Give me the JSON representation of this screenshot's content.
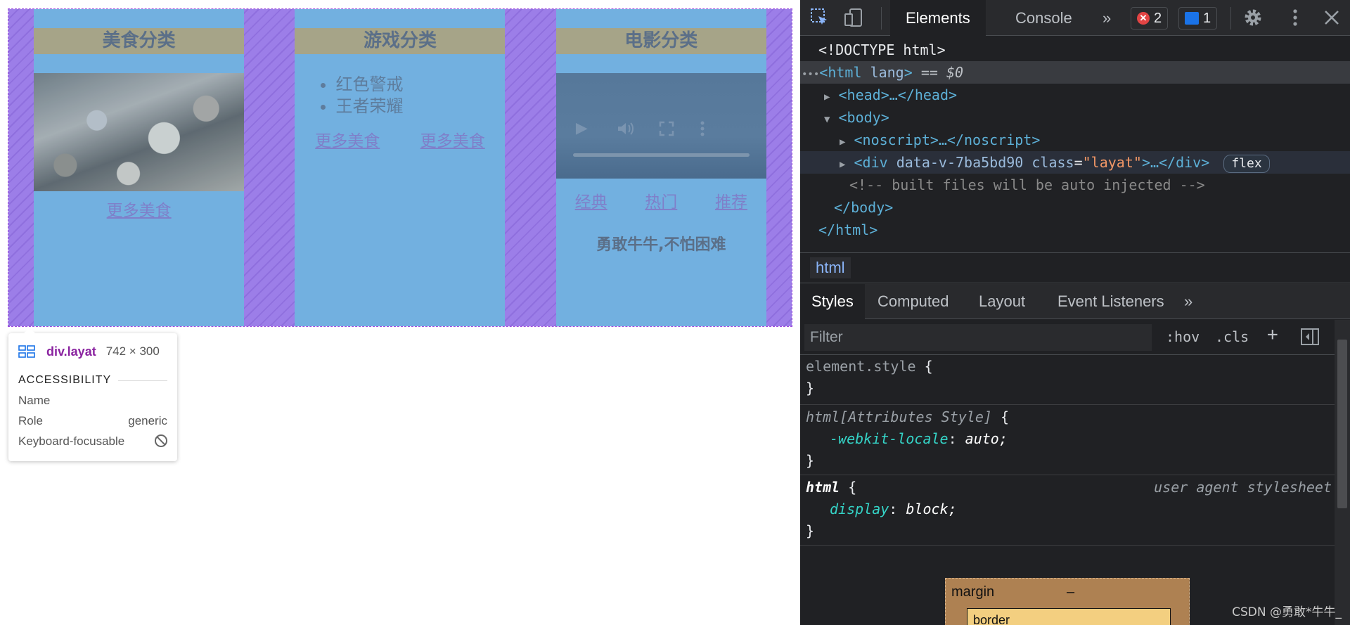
{
  "page": {
    "cards": {
      "food": {
        "title": "美食分类",
        "more_link": "更多美食"
      },
      "game": {
        "title": "游戏分类",
        "items": [
          "红色警戒",
          "王者荣耀"
        ],
        "links": [
          "更多美食",
          "更多美食"
        ]
      },
      "movie": {
        "title": "电影分类",
        "links": [
          "经典",
          "热门",
          "推荐"
        ],
        "motto": "勇敢牛牛,不怕困难"
      }
    },
    "tooltip": {
      "element_name": "div.layat",
      "size": "742 × 300",
      "section": "ACCESSIBILITY",
      "rows": [
        {
          "label": "Name",
          "value": ""
        },
        {
          "label": "Role",
          "value": "generic"
        },
        {
          "label": "Keyboard-focusable",
          "value": ""
        }
      ]
    }
  },
  "devtools": {
    "tabs": {
      "elements": "Elements",
      "console": "Console",
      "more": "»"
    },
    "errors_count": "2",
    "messages_count": "1",
    "error_glyph": "✕",
    "dom": {
      "doctype": "<!DOCTYPE html>",
      "html_open_tag": "<html",
      "html_attr": "lang",
      "html_rest": ">",
      "html_suffix": " == $0",
      "head": "<head>…</head>",
      "body_open": "<body>",
      "noscript": "<noscript>…</noscript>",
      "div_open": "<div",
      "div_attr1": "data-v-7ba5bd90",
      "div_attr2": "class",
      "div_attr2_val": "\"layat\"",
      "div_close": ">…</div>",
      "div_pill": "flex",
      "comment": "<!-- built files will be auto injected -->",
      "body_close": "</body>",
      "html_close": "</html>"
    },
    "breadcrumb": "html",
    "styles_tabs": {
      "styles": "Styles",
      "computed": "Computed",
      "layout": "Layout",
      "event_listeners": "Event Listeners",
      "more": "»"
    },
    "filter": {
      "placeholder": "Filter",
      "hov": ":hov",
      "cls": ".cls",
      "plus": "+"
    },
    "rules": {
      "element_style": "element.style",
      "attr_selector": "html[Attributes Style]",
      "attr_prop": "-webkit-locale",
      "attr_val": "auto;",
      "html_selector": "html",
      "ua_label": "user agent stylesheet",
      "html_prop": "display",
      "html_val": "block;",
      "open": "{",
      "close": "}"
    },
    "box_model": {
      "margin_label": "margin",
      "margin_value": "–",
      "border_label": "border"
    },
    "watermark": "CSDN @勇敢*牛牛_"
  }
}
